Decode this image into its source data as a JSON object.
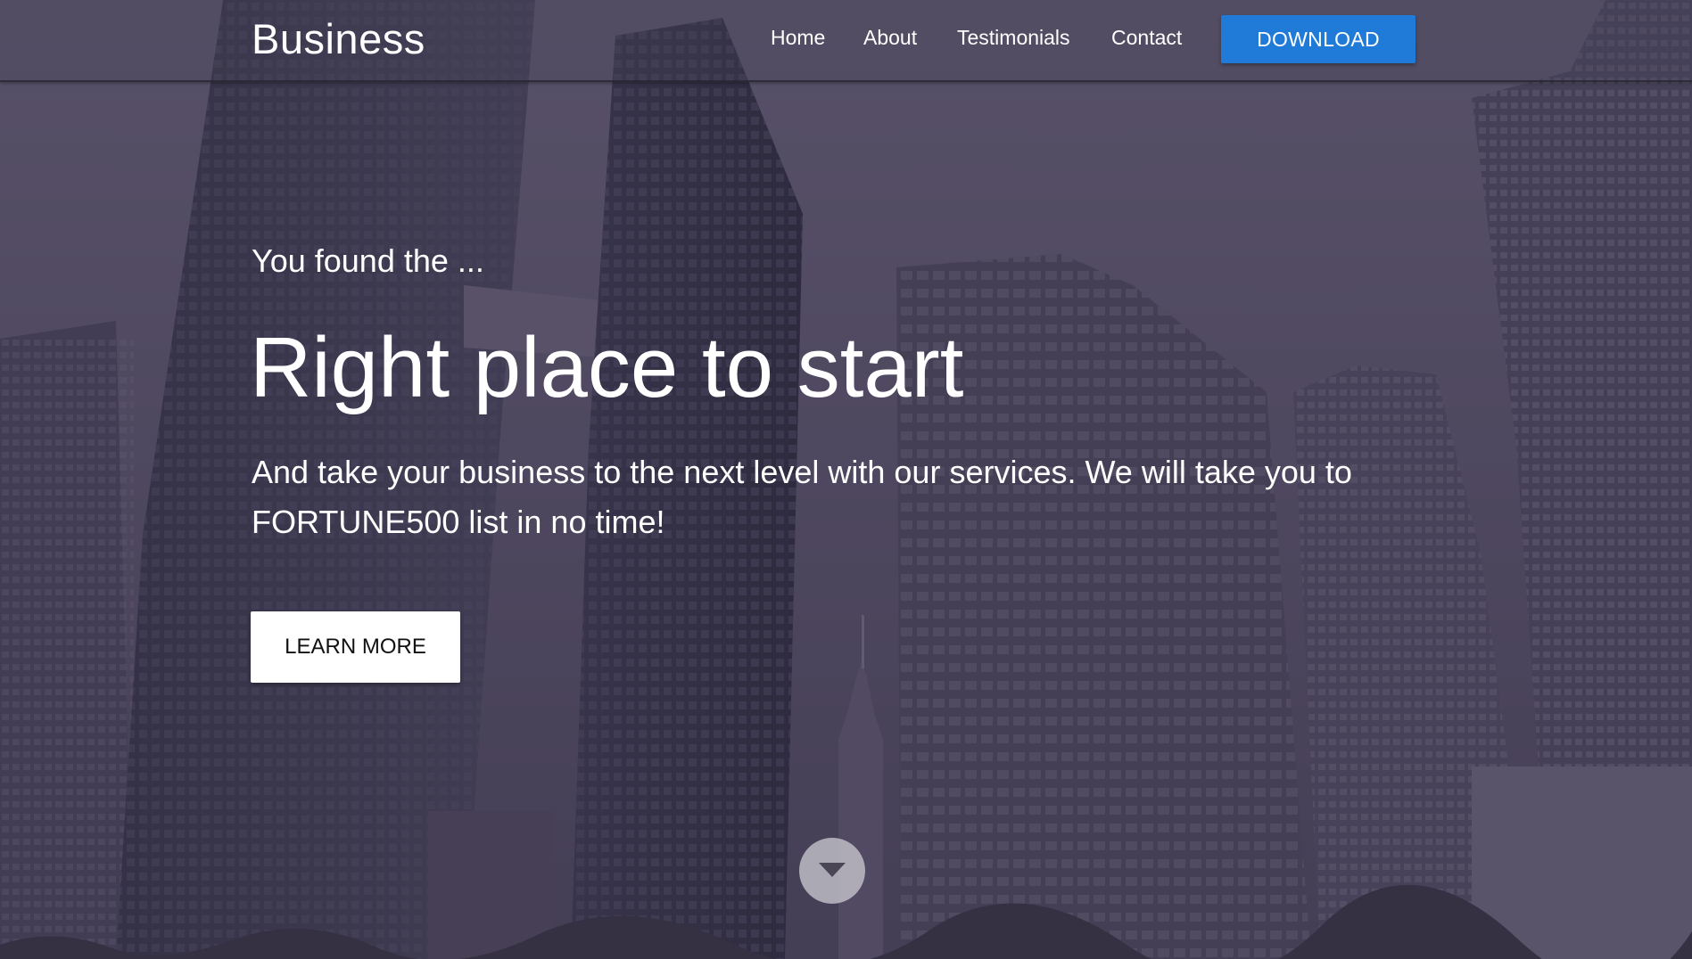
{
  "navbar": {
    "brand": "Business",
    "links": [
      {
        "label": "Home"
      },
      {
        "label": "About"
      },
      {
        "label": "Testimonials"
      },
      {
        "label": "Contact"
      }
    ],
    "download_label": "DOWNLOAD"
  },
  "hero": {
    "eyebrow": "You found the ...",
    "headline": "Right place to start",
    "subtext": "And take your business to the next level with our services. We will take you to FORTUNE500 list in no time!",
    "cta_label": "LEARN MORE",
    "scroll_icon": "chevron-down-icon"
  },
  "colors": {
    "accent": "#1f7ad8",
    "overlay": "#3e3854",
    "text": "#ffffff"
  }
}
